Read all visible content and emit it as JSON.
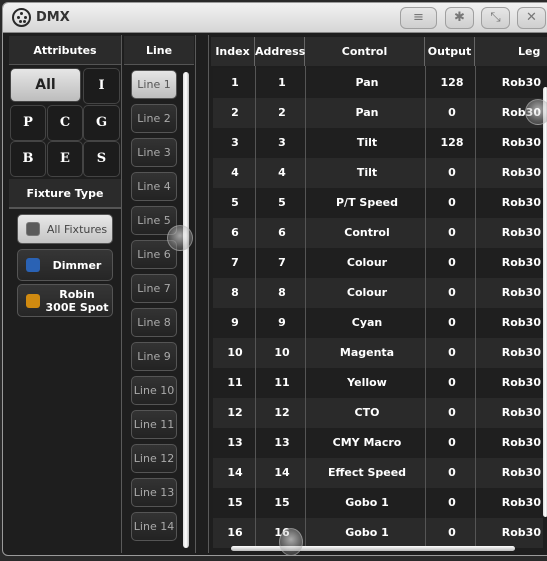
{
  "window": {
    "title": "DMX",
    "buttons": [
      {
        "name": "menu",
        "icon": "≡"
      },
      {
        "name": "settings",
        "icon": "✱"
      },
      {
        "name": "resize",
        "icon": "⤡"
      },
      {
        "name": "close",
        "icon": "✕"
      }
    ]
  },
  "attributes": {
    "header": "Attributes",
    "buttons": [
      "All",
      "I",
      "P",
      "C",
      "G",
      "B",
      "E",
      "S"
    ],
    "active": "All"
  },
  "fixture_type": {
    "header": "Fixture Type",
    "items": [
      {
        "label": "All Fixtures",
        "color": "#5a5a5a",
        "active": true
      },
      {
        "label": "Dimmer",
        "color": "#2a62b4",
        "active": false
      },
      {
        "label": "Robin 300E Spot",
        "color": "#d08a10",
        "active": false
      }
    ]
  },
  "line": {
    "header": "Line",
    "items": [
      "Line 1",
      "Line 2",
      "Line 3",
      "Line 4",
      "Line 5",
      "Line 6",
      "Line 7",
      "Line 8",
      "Line 9",
      "Line 10",
      "Line 11",
      "Line 12",
      "Line 13",
      "Line 14"
    ],
    "active": "Line 1"
  },
  "table": {
    "columns": [
      "Index",
      "Address",
      "Control",
      "Output",
      "Leg"
    ],
    "rows": [
      {
        "index": "1",
        "address": "1",
        "control": "Pan",
        "output": "128",
        "legend": "Rob30"
      },
      {
        "index": "2",
        "address": "2",
        "control": "Pan",
        "output": "0",
        "legend": "Rob30"
      },
      {
        "index": "3",
        "address": "3",
        "control": "Tilt",
        "output": "128",
        "legend": "Rob30"
      },
      {
        "index": "4",
        "address": "4",
        "control": "Tilt",
        "output": "0",
        "legend": "Rob30"
      },
      {
        "index": "5",
        "address": "5",
        "control": "P/T Speed",
        "output": "0",
        "legend": "Rob30"
      },
      {
        "index": "6",
        "address": "6",
        "control": "Control",
        "output": "0",
        "legend": "Rob30"
      },
      {
        "index": "7",
        "address": "7",
        "control": "Colour",
        "output": "0",
        "legend": "Rob30"
      },
      {
        "index": "8",
        "address": "8",
        "control": "Colour",
        "output": "0",
        "legend": "Rob30"
      },
      {
        "index": "9",
        "address": "9",
        "control": "Cyan",
        "output": "0",
        "legend": "Rob30"
      },
      {
        "index": "10",
        "address": "10",
        "control": "Magenta",
        "output": "0",
        "legend": "Rob30"
      },
      {
        "index": "11",
        "address": "11",
        "control": "Yellow",
        "output": "0",
        "legend": "Rob30"
      },
      {
        "index": "12",
        "address": "12",
        "control": "CTO",
        "output": "0",
        "legend": "Rob30"
      },
      {
        "index": "13",
        "address": "13",
        "control": "CMY Macro",
        "output": "0",
        "legend": "Rob30"
      },
      {
        "index": "14",
        "address": "14",
        "control": "Effect Speed",
        "output": "0",
        "legend": "Rob30"
      },
      {
        "index": "15",
        "address": "15",
        "control": "Gobo 1",
        "output": "0",
        "legend": "Rob30"
      },
      {
        "index": "16",
        "address": "16",
        "control": "Gobo 1",
        "output": "0",
        "legend": "Rob30"
      }
    ]
  }
}
